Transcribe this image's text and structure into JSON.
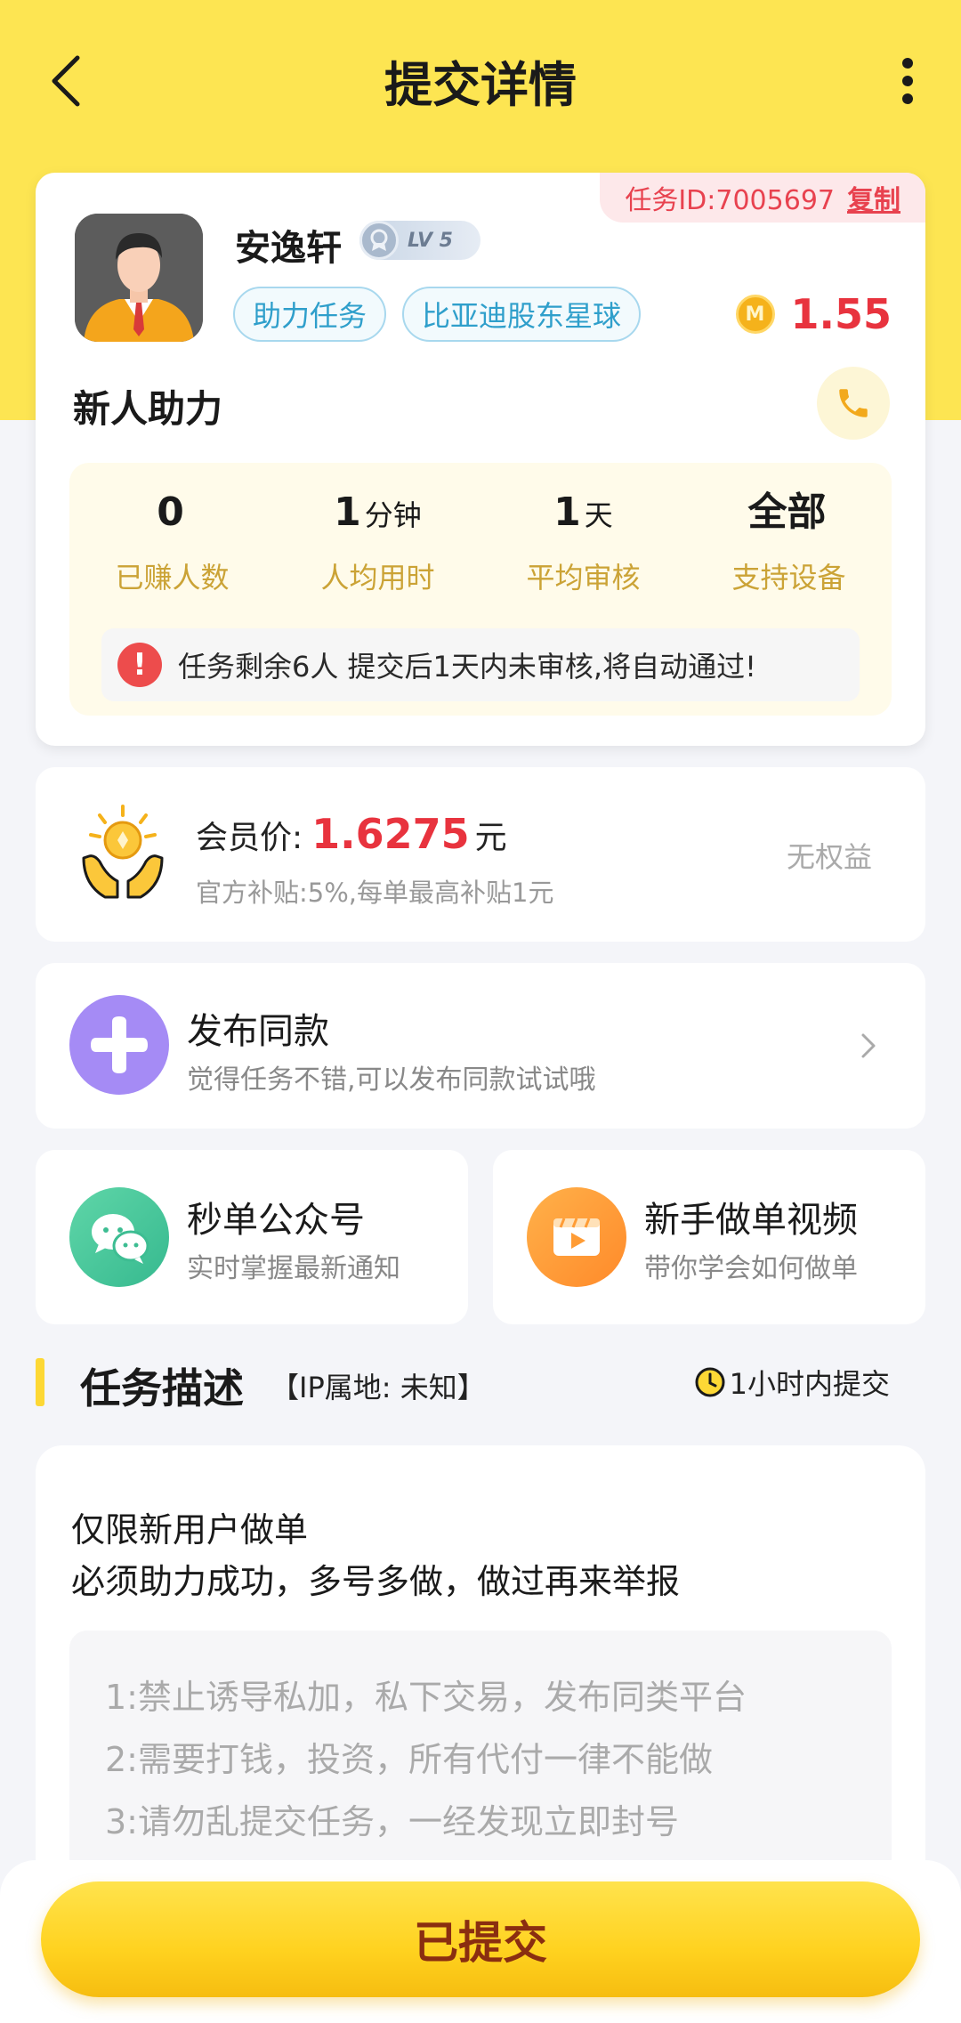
{
  "header": {
    "title": "提交详情"
  },
  "task": {
    "id_label": "任务ID:7005697",
    "copy_label": "复制",
    "user_name": "安逸轩",
    "level": "LV 5",
    "tags": [
      "助力任务",
      "比亚迪股东星球"
    ],
    "coin_letter": "M",
    "reward": "1.55",
    "title": "新人助力",
    "stats": [
      {
        "value": "0",
        "unit": "",
        "label": "已赚人数"
      },
      {
        "value": "1",
        "unit": "分钟",
        "label": "人均用时"
      },
      {
        "value": "1",
        "unit": "天",
        "label": "平均审核"
      },
      {
        "value": "全部",
        "unit": "",
        "label": "支持设备"
      }
    ],
    "notice": "任务剩余6人  提交后1天内未审核,将自动通过!"
  },
  "member": {
    "label": "会员价:",
    "price": "1.6275",
    "currency": "元",
    "subtitle": "官方补贴:5%,每单最高补贴1元",
    "rights": "无权益"
  },
  "publish": {
    "title": "发布同款",
    "subtitle": "觉得任务不错,可以发布同款试试哦"
  },
  "shortcuts": [
    {
      "title": "秒单公众号",
      "subtitle": "实时掌握最新通知"
    },
    {
      "title": "新手做单视频",
      "subtitle": "带你学会如何做单"
    }
  ],
  "section": {
    "title": "任务描述",
    "ip": "【IP属地:  未知】",
    "time_limit": "1小时内提交"
  },
  "description": {
    "lines": [
      "仅限新用户做单",
      "必须助力成功，多号多做，做过再来举报"
    ],
    "rules": [
      "1:禁止诱导私加，私下交易，发布同类平台",
      "2:需要打钱，投资，所有代付一律不能做",
      "3:请勿乱提交任务，一经发现立即封号"
    ]
  },
  "footer": {
    "submit_label": "已提交"
  },
  "colors": {
    "accent": "#fde552",
    "price_red": "#e8333e",
    "tag_blue": "#2f9fcb",
    "stat_gold": "#cba336"
  }
}
